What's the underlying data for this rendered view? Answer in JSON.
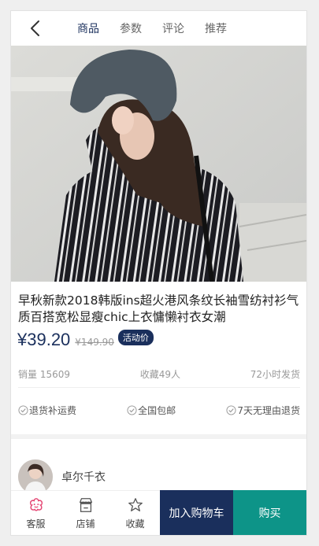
{
  "header": {
    "tabs": [
      {
        "label": "商品",
        "active": true
      },
      {
        "label": "参数",
        "active": false
      },
      {
        "label": "评论",
        "active": false
      },
      {
        "label": "推荐",
        "active": false
      }
    ]
  },
  "product": {
    "title": "早秋新款2018韩版ins超火港风条纹长袖雪纺衬衫气质百搭宽松显瘦chic上衣慵懒衬衣女潮",
    "price": "¥39.20",
    "old_price": "¥149.90",
    "badge": "活动价",
    "stats": {
      "sales": "销量 15609",
      "favorites": "收藏49人",
      "shipping": "72小时发货"
    },
    "promises": [
      {
        "label": "退货补运费",
        "icon": "check-circle-icon"
      },
      {
        "label": "全国包邮",
        "icon": "check-circle-icon"
      },
      {
        "label": "7天无理由退货",
        "icon": "check-circle-icon"
      }
    ]
  },
  "shop": {
    "name": "卓尔千衣"
  },
  "bottom_bar": {
    "service": "客服",
    "store": "店铺",
    "favorite": "收藏",
    "add_to_cart": "加入购物车",
    "buy": "购买"
  },
  "colors": {
    "accent": "#1a2f5c",
    "buy": "#0d9488",
    "service_icon": "#e4406f"
  }
}
